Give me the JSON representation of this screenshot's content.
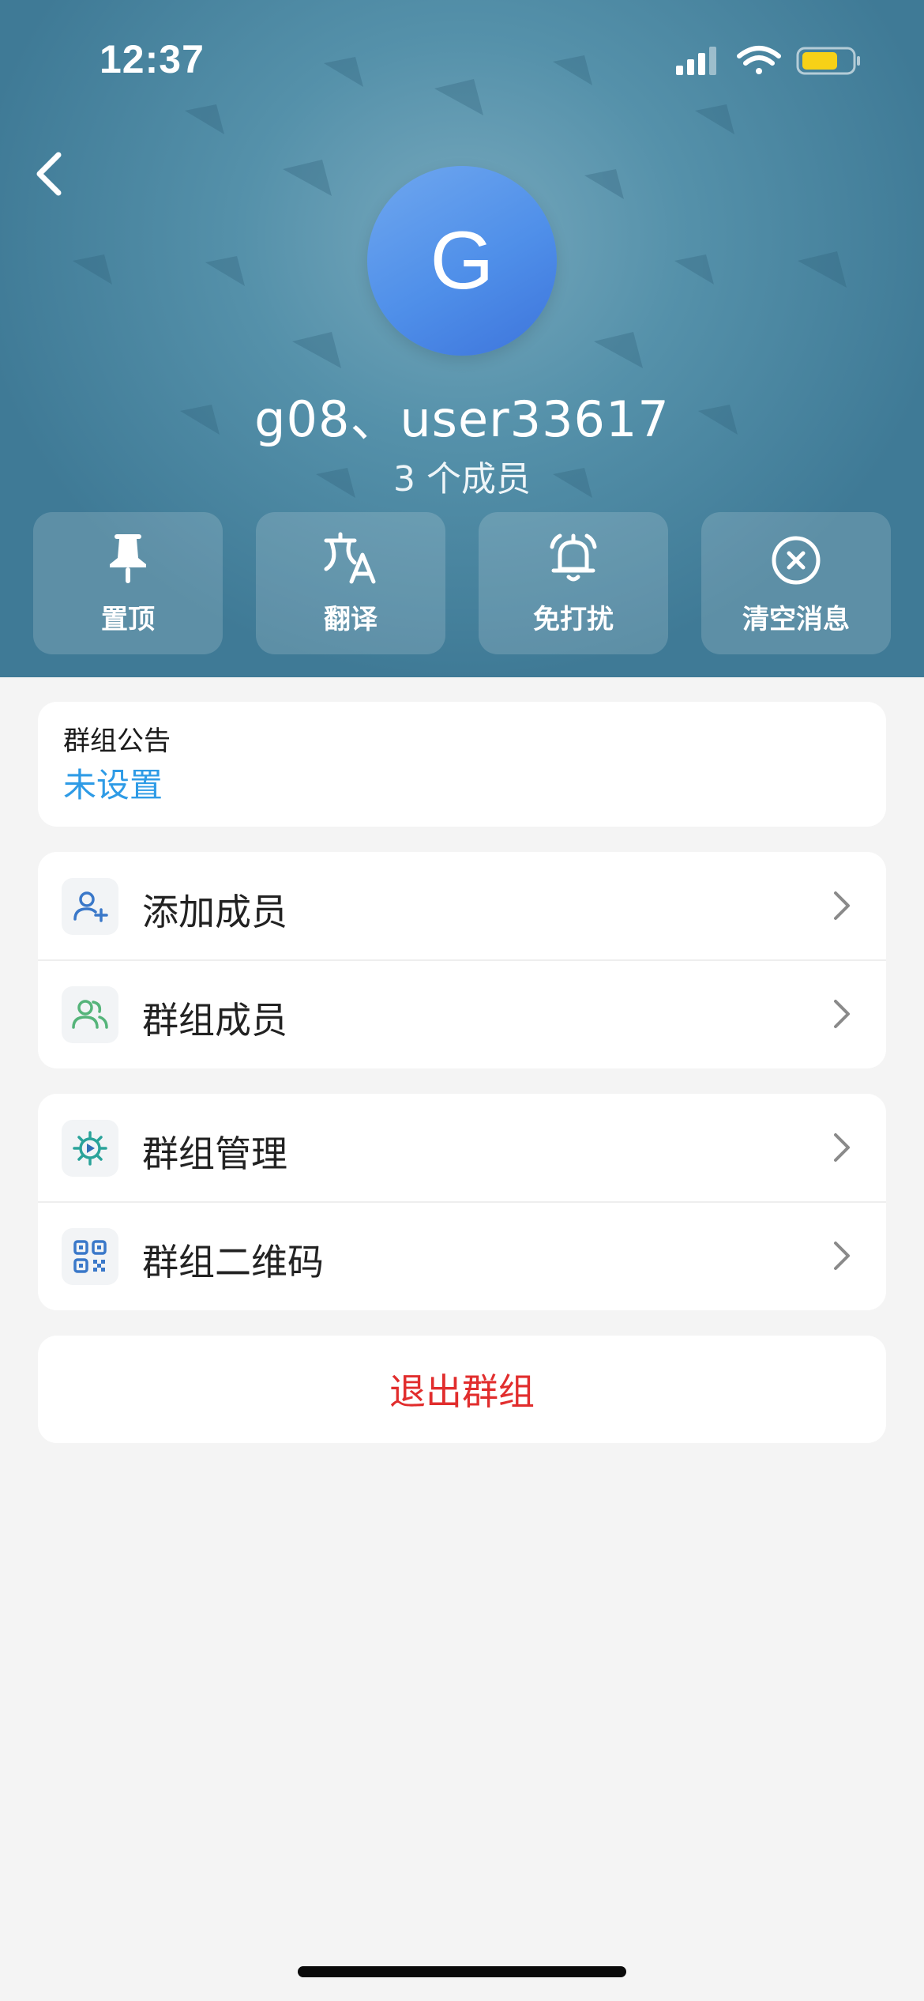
{
  "status_bar": {
    "time": "12:37",
    "battery_color": "#f7d117"
  },
  "header": {
    "avatar_letter": "G",
    "group_name": "g08、user33617",
    "member_count": "3 个成员",
    "actions": [
      {
        "label": "置顶",
        "icon": "pin-icon"
      },
      {
        "label": "翻译",
        "icon": "translate-icon"
      },
      {
        "label": "免打扰",
        "icon": "bell-icon"
      },
      {
        "label": "清空消息",
        "icon": "clear-circle-icon"
      }
    ]
  },
  "notice": {
    "title": "群组公告",
    "value": "未设置"
  },
  "menu": {
    "add_member": "添加成员",
    "group_members": "群组成员",
    "group_manage": "群组管理",
    "group_qrcode": "群组二维码"
  },
  "exit_label": "退出群组",
  "colors": {
    "accent_blue": "#2e9be6",
    "danger_red": "#e12d2d",
    "header_bg": "#4f8aa4"
  }
}
